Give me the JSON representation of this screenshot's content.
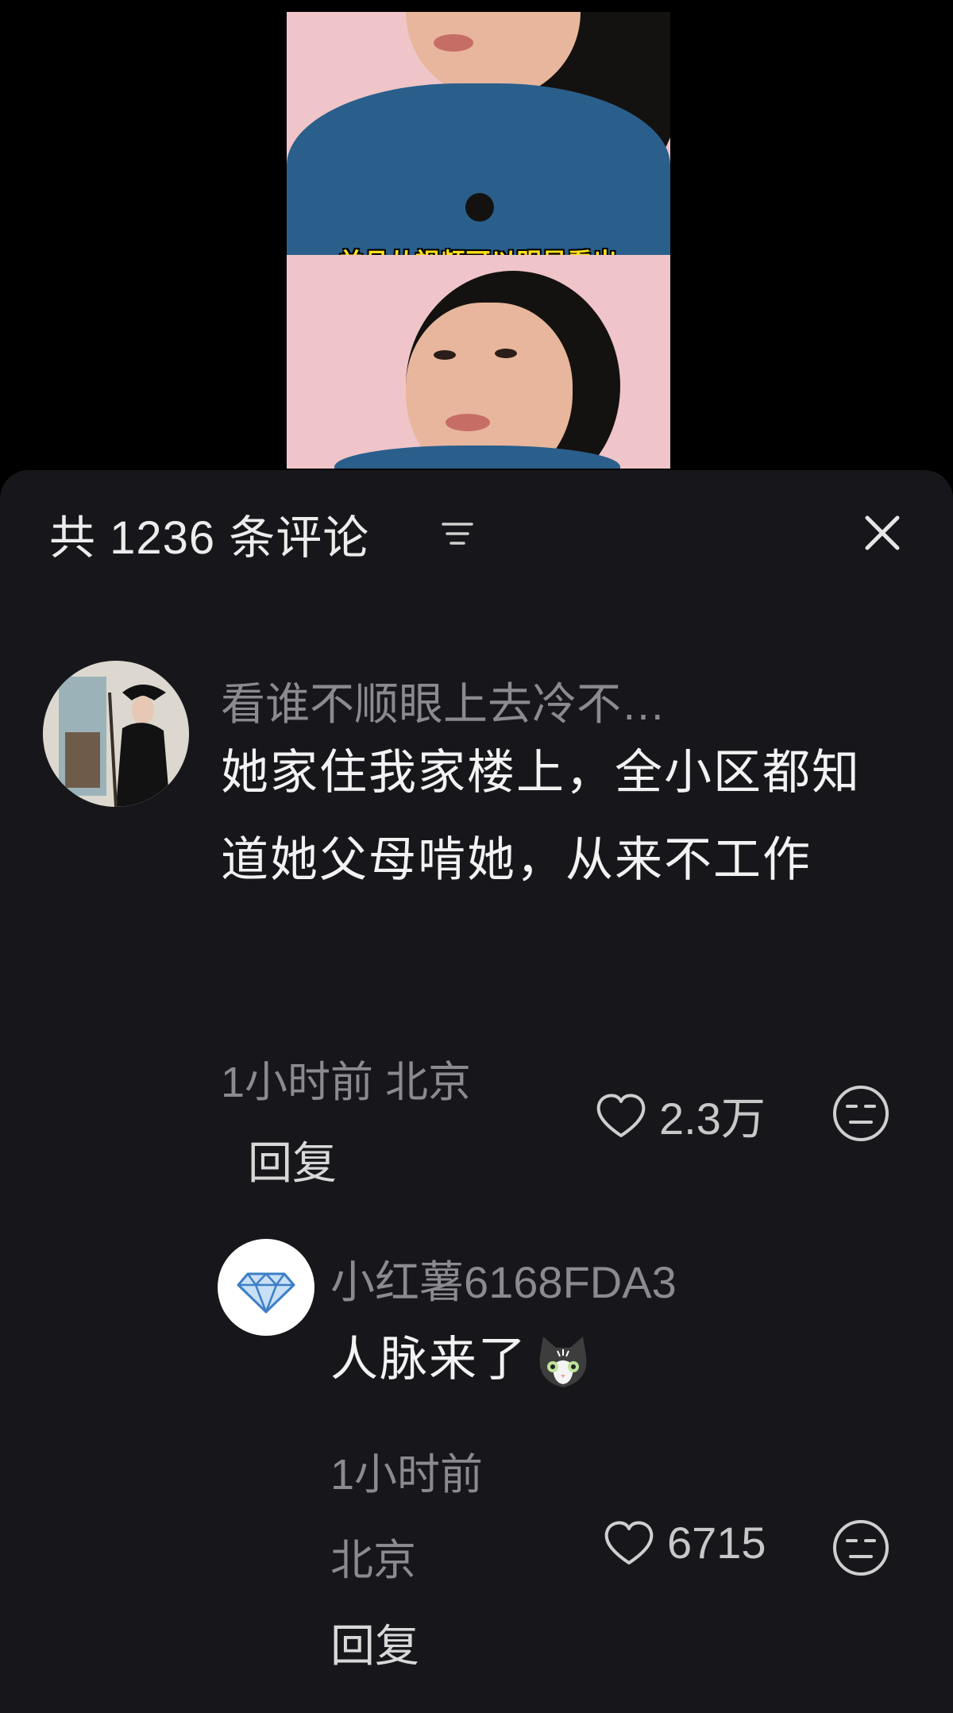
{
  "video": {
    "subtitle": "并且从视频可以明显看出"
  },
  "comments_panel": {
    "title": "共 1236 条评论",
    "sort_icon": "filter-lines-icon",
    "close_icon": "close-icon"
  },
  "comments": [
    {
      "username": "看谁不顺眼上去冷不…",
      "text": "她家住我家楼上，全小区都知道她父母啃她，从来不工作",
      "time_location": "1小时前 北京",
      "reply_label": "回复",
      "likes": "2.3万",
      "emoji_icon": "neutral-face-icon"
    },
    {
      "username": "小红薯6168FDA3",
      "text": "人脉来了",
      "emoji_inline": "cat-face-icon",
      "time": "1小时前",
      "location": "北京",
      "reply_label": "回复",
      "likes": "6715",
      "emoji_icon": "neutral-face-icon"
    }
  ]
}
